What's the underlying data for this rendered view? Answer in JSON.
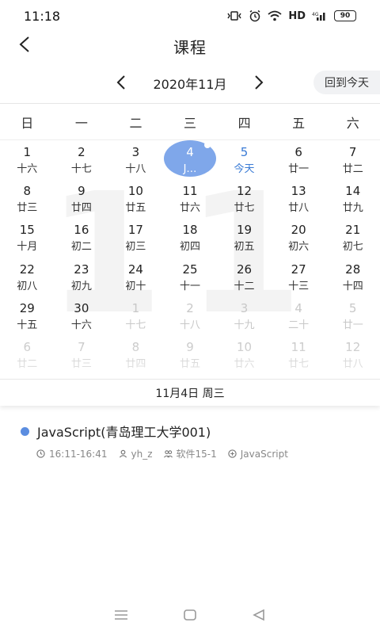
{
  "status": {
    "time": "11:18",
    "network": "HD",
    "battery": "90"
  },
  "header": {
    "title": "课程"
  },
  "month_nav": {
    "label": "2020年11月",
    "today_button": "回到今天"
  },
  "calendar": {
    "background_month": "11",
    "weekdays": [
      "日",
      "一",
      "二",
      "三",
      "四",
      "五",
      "六"
    ],
    "days": [
      {
        "d": "1",
        "l": "十六",
        "state": ""
      },
      {
        "d": "2",
        "l": "十七",
        "state": ""
      },
      {
        "d": "3",
        "l": "十八",
        "state": ""
      },
      {
        "d": "4",
        "l": "J…",
        "state": "selected"
      },
      {
        "d": "5",
        "l": "今天",
        "state": "today"
      },
      {
        "d": "6",
        "l": "廿一",
        "state": ""
      },
      {
        "d": "7",
        "l": "廿二",
        "state": ""
      },
      {
        "d": "8",
        "l": "廿三",
        "state": ""
      },
      {
        "d": "9",
        "l": "廿四",
        "state": ""
      },
      {
        "d": "10",
        "l": "廿五",
        "state": ""
      },
      {
        "d": "11",
        "l": "廿六",
        "state": ""
      },
      {
        "d": "12",
        "l": "廿七",
        "state": ""
      },
      {
        "d": "13",
        "l": "廿八",
        "state": ""
      },
      {
        "d": "14",
        "l": "廿九",
        "state": ""
      },
      {
        "d": "15",
        "l": "十月",
        "state": ""
      },
      {
        "d": "16",
        "l": "初二",
        "state": ""
      },
      {
        "d": "17",
        "l": "初三",
        "state": ""
      },
      {
        "d": "18",
        "l": "初四",
        "state": ""
      },
      {
        "d": "19",
        "l": "初五",
        "state": ""
      },
      {
        "d": "20",
        "l": "初六",
        "state": ""
      },
      {
        "d": "21",
        "l": "初七",
        "state": ""
      },
      {
        "d": "22",
        "l": "初八",
        "state": ""
      },
      {
        "d": "23",
        "l": "初九",
        "state": ""
      },
      {
        "d": "24",
        "l": "初十",
        "state": ""
      },
      {
        "d": "25",
        "l": "十一",
        "state": ""
      },
      {
        "d": "26",
        "l": "十二",
        "state": ""
      },
      {
        "d": "27",
        "l": "十三",
        "state": ""
      },
      {
        "d": "28",
        "l": "十四",
        "state": ""
      },
      {
        "d": "29",
        "l": "十五",
        "state": ""
      },
      {
        "d": "30",
        "l": "十六",
        "state": ""
      },
      {
        "d": "1",
        "l": "十七",
        "state": "other"
      },
      {
        "d": "2",
        "l": "十八",
        "state": "other"
      },
      {
        "d": "3",
        "l": "十九",
        "state": "other"
      },
      {
        "d": "4",
        "l": "二十",
        "state": "other"
      },
      {
        "d": "5",
        "l": "廿一",
        "state": "other"
      },
      {
        "d": "6",
        "l": "廿二",
        "state": "other"
      },
      {
        "d": "7",
        "l": "廿三",
        "state": "other"
      },
      {
        "d": "8",
        "l": "廿四",
        "state": "other"
      },
      {
        "d": "9",
        "l": "廿五",
        "state": "other"
      },
      {
        "d": "10",
        "l": "廿六",
        "state": "other"
      },
      {
        "d": "11",
        "l": "廿七",
        "state": "other"
      },
      {
        "d": "12",
        "l": "廿八",
        "state": "other"
      }
    ]
  },
  "selected_date_label": "11月4日 周三",
  "courses": [
    {
      "title": "JavaScript(青岛理工大学001)",
      "time": "16:11-16:41",
      "teacher": "yh_z",
      "class": "软件15-1",
      "subject": "JavaScript",
      "color": "#5b8de0"
    }
  ],
  "colors": {
    "accent": "#3a7bd5",
    "selected": "#7fa7ea"
  }
}
